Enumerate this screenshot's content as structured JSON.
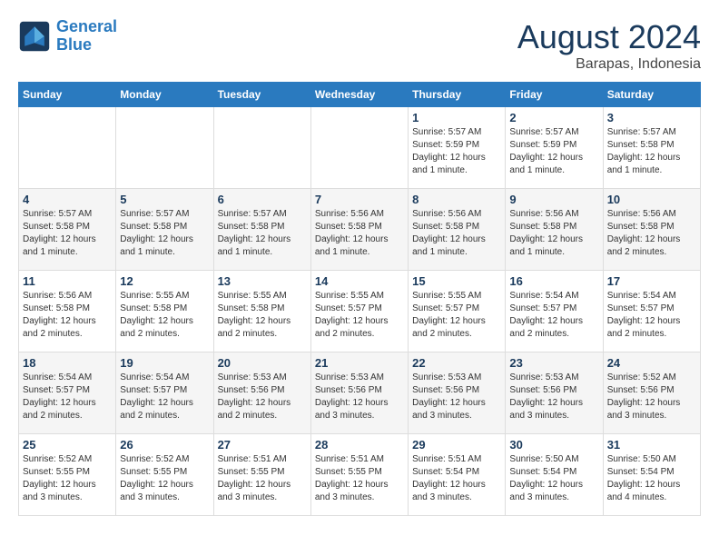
{
  "header": {
    "logo_line1": "General",
    "logo_line2": "Blue",
    "main_title": "August 2024",
    "subtitle": "Barapas, Indonesia"
  },
  "days_of_week": [
    "Sunday",
    "Monday",
    "Tuesday",
    "Wednesday",
    "Thursday",
    "Friday",
    "Saturday"
  ],
  "weeks": [
    [
      {
        "day": "",
        "info": ""
      },
      {
        "day": "",
        "info": ""
      },
      {
        "day": "",
        "info": ""
      },
      {
        "day": "",
        "info": ""
      },
      {
        "day": "1",
        "info": "Sunrise: 5:57 AM\nSunset: 5:59 PM\nDaylight: 12 hours\nand 1 minute."
      },
      {
        "day": "2",
        "info": "Sunrise: 5:57 AM\nSunset: 5:59 PM\nDaylight: 12 hours\nand 1 minute."
      },
      {
        "day": "3",
        "info": "Sunrise: 5:57 AM\nSunset: 5:58 PM\nDaylight: 12 hours\nand 1 minute."
      }
    ],
    [
      {
        "day": "4",
        "info": "Sunrise: 5:57 AM\nSunset: 5:58 PM\nDaylight: 12 hours\nand 1 minute."
      },
      {
        "day": "5",
        "info": "Sunrise: 5:57 AM\nSunset: 5:58 PM\nDaylight: 12 hours\nand 1 minute."
      },
      {
        "day": "6",
        "info": "Sunrise: 5:57 AM\nSunset: 5:58 PM\nDaylight: 12 hours\nand 1 minute."
      },
      {
        "day": "7",
        "info": "Sunrise: 5:56 AM\nSunset: 5:58 PM\nDaylight: 12 hours\nand 1 minute."
      },
      {
        "day": "8",
        "info": "Sunrise: 5:56 AM\nSunset: 5:58 PM\nDaylight: 12 hours\nand 1 minute."
      },
      {
        "day": "9",
        "info": "Sunrise: 5:56 AM\nSunset: 5:58 PM\nDaylight: 12 hours\nand 1 minute."
      },
      {
        "day": "10",
        "info": "Sunrise: 5:56 AM\nSunset: 5:58 PM\nDaylight: 12 hours\nand 2 minutes."
      }
    ],
    [
      {
        "day": "11",
        "info": "Sunrise: 5:56 AM\nSunset: 5:58 PM\nDaylight: 12 hours\nand 2 minutes."
      },
      {
        "day": "12",
        "info": "Sunrise: 5:55 AM\nSunset: 5:58 PM\nDaylight: 12 hours\nand 2 minutes."
      },
      {
        "day": "13",
        "info": "Sunrise: 5:55 AM\nSunset: 5:58 PM\nDaylight: 12 hours\nand 2 minutes."
      },
      {
        "day": "14",
        "info": "Sunrise: 5:55 AM\nSunset: 5:57 PM\nDaylight: 12 hours\nand 2 minutes."
      },
      {
        "day": "15",
        "info": "Sunrise: 5:55 AM\nSunset: 5:57 PM\nDaylight: 12 hours\nand 2 minutes."
      },
      {
        "day": "16",
        "info": "Sunrise: 5:54 AM\nSunset: 5:57 PM\nDaylight: 12 hours\nand 2 minutes."
      },
      {
        "day": "17",
        "info": "Sunrise: 5:54 AM\nSunset: 5:57 PM\nDaylight: 12 hours\nand 2 minutes."
      }
    ],
    [
      {
        "day": "18",
        "info": "Sunrise: 5:54 AM\nSunset: 5:57 PM\nDaylight: 12 hours\nand 2 minutes."
      },
      {
        "day": "19",
        "info": "Sunrise: 5:54 AM\nSunset: 5:57 PM\nDaylight: 12 hours\nand 2 minutes."
      },
      {
        "day": "20",
        "info": "Sunrise: 5:53 AM\nSunset: 5:56 PM\nDaylight: 12 hours\nand 2 minutes."
      },
      {
        "day": "21",
        "info": "Sunrise: 5:53 AM\nSunset: 5:56 PM\nDaylight: 12 hours\nand 3 minutes."
      },
      {
        "day": "22",
        "info": "Sunrise: 5:53 AM\nSunset: 5:56 PM\nDaylight: 12 hours\nand 3 minutes."
      },
      {
        "day": "23",
        "info": "Sunrise: 5:53 AM\nSunset: 5:56 PM\nDaylight: 12 hours\nand 3 minutes."
      },
      {
        "day": "24",
        "info": "Sunrise: 5:52 AM\nSunset: 5:56 PM\nDaylight: 12 hours\nand 3 minutes."
      }
    ],
    [
      {
        "day": "25",
        "info": "Sunrise: 5:52 AM\nSunset: 5:55 PM\nDaylight: 12 hours\nand 3 minutes."
      },
      {
        "day": "26",
        "info": "Sunrise: 5:52 AM\nSunset: 5:55 PM\nDaylight: 12 hours\nand 3 minutes."
      },
      {
        "day": "27",
        "info": "Sunrise: 5:51 AM\nSunset: 5:55 PM\nDaylight: 12 hours\nand 3 minutes."
      },
      {
        "day": "28",
        "info": "Sunrise: 5:51 AM\nSunset: 5:55 PM\nDaylight: 12 hours\nand 3 minutes."
      },
      {
        "day": "29",
        "info": "Sunrise: 5:51 AM\nSunset: 5:54 PM\nDaylight: 12 hours\nand 3 minutes."
      },
      {
        "day": "30",
        "info": "Sunrise: 5:50 AM\nSunset: 5:54 PM\nDaylight: 12 hours\nand 3 minutes."
      },
      {
        "day": "31",
        "info": "Sunrise: 5:50 AM\nSunset: 5:54 PM\nDaylight: 12 hours\nand 4 minutes."
      }
    ]
  ]
}
